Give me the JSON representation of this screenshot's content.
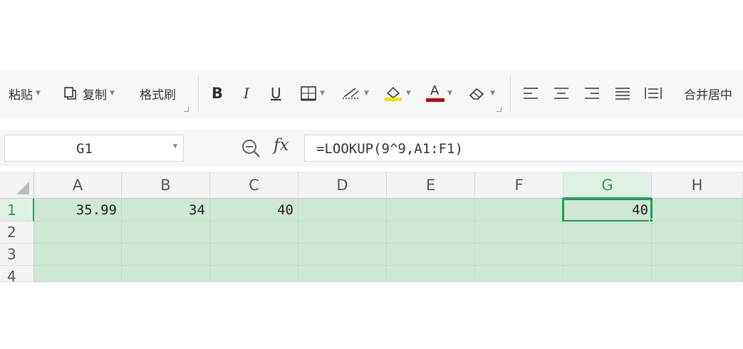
{
  "toolbar": {
    "paste_label": "粘贴",
    "copy_label": "复制",
    "format_painter_label": "格式刷",
    "bold_glyph": "B",
    "italic_glyph": "I",
    "underline_glyph": "U",
    "font_color_glyph": "A",
    "merge_label": "合并居中"
  },
  "formula_bar": {
    "name_box": "G1",
    "fx_label": "fx",
    "formula": "=LOOKUP(9^9,A1:F1)"
  },
  "sheet": {
    "columns": [
      "A",
      "B",
      "C",
      "D",
      "E",
      "F",
      "G",
      "H"
    ],
    "active_column": "G",
    "rows": [
      "1",
      "2",
      "3",
      "4"
    ],
    "active_row": "1",
    "row1": {
      "A": "35.99",
      "B": "34",
      "C": "40",
      "D": "",
      "E": "",
      "F": "",
      "G": "40",
      "H": ""
    }
  },
  "colors": {
    "selection_fill": "#cfe8d6",
    "active_border": "#1f9d55",
    "highlight_fill": "#f2e600",
    "font_color_bar": "#c00000"
  }
}
